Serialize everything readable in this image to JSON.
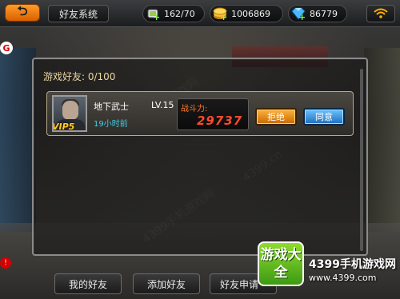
{
  "topbar": {
    "title": "好友系统",
    "energy": "162/70",
    "gold": "1006869",
    "gems": "86779"
  },
  "friends_panel": {
    "title": "游戏好友: 0/100",
    "requests": [
      {
        "name": "地下武士",
        "level": "LV.15",
        "time": "19小时前",
        "vip": "VIP5",
        "power_label": "战斗力:",
        "power_value": "29737",
        "reject_label": "拒绝",
        "accept_label": "同意"
      }
    ]
  },
  "tabs": {
    "my_friends": "我的好友",
    "add_friend": "添加好友",
    "friend_requests": "好友申请"
  },
  "watermark": {
    "logo_text": "游戏大全",
    "site_name": "4399手机游戏网",
    "url": "www.4399.com"
  },
  "colors": {
    "accent_orange": "#ff9c2a",
    "accent_blue": "#1d6fbf",
    "power_red": "#ff4a2a",
    "time_cyan": "#3fd0e8"
  }
}
